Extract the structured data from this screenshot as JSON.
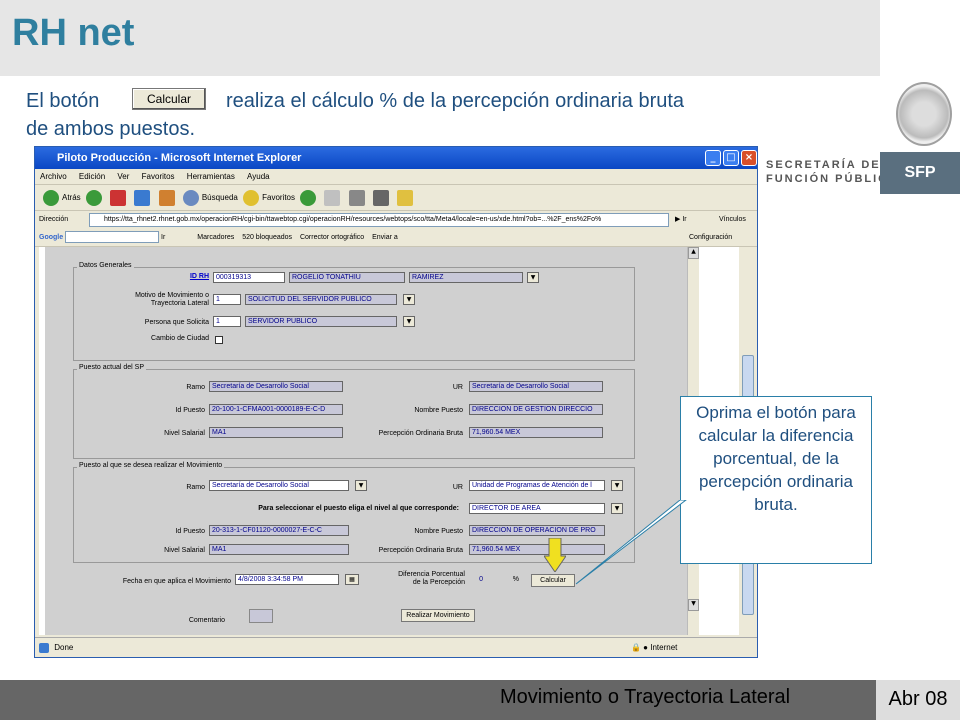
{
  "slide": {
    "title": "RH net",
    "intro_part1": "El botón",
    "intro_btn": "Calcular",
    "intro_part2": "realiza el cálculo % de la percepción ordinaria bruta",
    "intro_line2": "de ambos puestos."
  },
  "logo": {
    "secretaria_line1": "SECRETARÍA DE LA",
    "secretaria_line2": "FUNCIÓN PÚBLICA",
    "sfp": "SFP"
  },
  "footer": {
    "title": "Movimiento o Trayectoria Lateral",
    "date": "Abr 08"
  },
  "browser": {
    "title": "Piloto Producción - Microsoft Internet Explorer",
    "menu": [
      "Archivo",
      "Edición",
      "Ver",
      "Favoritos",
      "Herramientas",
      "Ayuda"
    ],
    "toolbar": {
      "back": "Atrás",
      "search": "Búsqueda",
      "favorites": "Favoritos"
    },
    "address_label": "Dirección",
    "address": "https://tta_rhnet2.rhnet.gob.mx/operacionRH/cgi-bin/ttawebtop.cgi/operacionRH/resources/webtops/sco/tta/Meta4/locale=en-us/xde.html?ob=...%2F_ens%2Fo%",
    "go": "Ir",
    "links": "Vínculos",
    "google_bar": {
      "ir": "Ir",
      "marcadores": "Marcadores",
      "bloqueados": "520 bloqueados",
      "corrector": "Corrector ortográfico",
      "enviar": "Enviar a",
      "config": "Configuración"
    },
    "status": "Done",
    "zone": "Internet"
  },
  "form": {
    "datos": {
      "legend": "Datos Generales",
      "id_rh_label": "ID RH",
      "id_rh": "000319313",
      "nombre": "ROGELIO TONATHIU",
      "apellido": "RAMIREZ",
      "motivo_label": "Motivo  de Movimiento o Trayectoria Lateral",
      "motivo_code": "1",
      "motivo": "SOLICITUD DEL SERVIDOR PUBLICO",
      "persona_label": "Persona que Solicita",
      "persona_code": "1",
      "persona": "SERVIDOR PUBLICO",
      "cambio_label": "Cambio de Ciudad"
    },
    "actual": {
      "legend": "Puesto actual del SP",
      "ramo_label": "Ramo",
      "ramo": "Secretaría de Desarrollo Social",
      "ur_label": "UR",
      "ur": "Secretaría de Desarrollo Social",
      "id_label": "Id Puesto",
      "id": "20-100-1-CFMA001-0000189-E-C-D",
      "nombre_label": "Nombre Puesto",
      "nombre": "DIRECCION DE GESTION DIRECCIO",
      "nivel_label": "Nivel Salarial",
      "nivel": "MA1",
      "perc_label": "Percepción Ordinaria Bruta",
      "perc": "71,960.54 MEX"
    },
    "deseado": {
      "legend": "Puesto al que se desea realizar el Movimiento",
      "ramo_label": "Ramo",
      "ramo": "Secretaría de Desarrollo Social",
      "ur_label": "UR",
      "ur": "Unidad de Programas de Atención de l",
      "sel_label": "Para seleccionar el puesto eliga el nivel al que corresponde:",
      "sel": "DIRECTOR DE AREA",
      "id_label": "Id Puesto",
      "id": "20-313-1-CF01120-0000027-E-C-C",
      "nombre_label": "Nombre Puesto",
      "nombre": "DIRECCION DE OPERACION DE PRO",
      "nivel_label": "Nivel Salarial",
      "nivel": "MA1",
      "perc_label": "Percepción Ordinaria Bruta",
      "perc": "71,960.54 MEX"
    },
    "fecha_label": "Fecha en que aplica el Movimiento",
    "fecha": "4/8/2008 3:34:58 PM",
    "dif_label1": "Diferencia Porcentual",
    "dif_label2": "de la Percepción",
    "dif": "0",
    "pct": "%",
    "calcular": "Calcular",
    "comentario_label": "Comentario",
    "realizar": "Realizar Movimiento"
  },
  "callout": {
    "text": "Oprima el botón para calcular la diferencia porcentual, de la percepción ordinaria bruta."
  },
  "colors": {
    "title": "#2f7f9f",
    "text": "#1f4f7f",
    "arrow": "#f0e020"
  }
}
